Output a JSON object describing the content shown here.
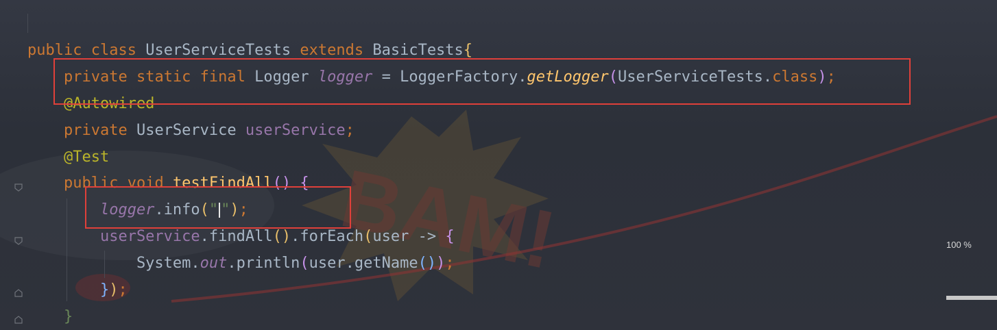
{
  "editor": {
    "zoom_level": "100 %",
    "lines": [
      {
        "tokens": [
          {
            "text": "public ",
            "cls": "kw"
          },
          {
            "text": "class ",
            "cls": "kw"
          },
          {
            "text": "UserServiceTests ",
            "cls": "cls"
          },
          {
            "text": "extends ",
            "cls": "kw"
          },
          {
            "text": "BasicTests",
            "cls": "cls"
          },
          {
            "text": "{",
            "cls": "paren1"
          }
        ]
      },
      {
        "tokens": [
          {
            "text": "    private ",
            "cls": "kw"
          },
          {
            "text": "static ",
            "cls": "kw"
          },
          {
            "text": "final ",
            "cls": "kw"
          },
          {
            "text": "Logger ",
            "cls": "cls"
          },
          {
            "text": "logger",
            "cls": "field-it"
          },
          {
            "text": " = LoggerFactory.",
            "cls": "plain"
          },
          {
            "text": "getLogger",
            "cls": "method-it"
          },
          {
            "text": "(",
            "cls": "paren2"
          },
          {
            "text": "UserServiceTests.",
            "cls": "plain"
          },
          {
            "text": "class",
            "cls": "kw"
          },
          {
            "text": ")",
            "cls": "paren2"
          },
          {
            "text": ";",
            "cls": "kw"
          }
        ]
      },
      {
        "tokens": [
          {
            "text": "    @Autowired",
            "cls": "ann"
          }
        ]
      },
      {
        "tokens": [
          {
            "text": "    private ",
            "cls": "kw"
          },
          {
            "text": "UserService ",
            "cls": "cls"
          },
          {
            "text": "userService",
            "cls": "field"
          },
          {
            "text": ";",
            "cls": "kw"
          }
        ]
      },
      {
        "tokens": [
          {
            "text": "    @Test",
            "cls": "ann"
          }
        ]
      },
      {
        "tokens": [
          {
            "text": "    public ",
            "cls": "kw"
          },
          {
            "text": "void ",
            "cls": "kw"
          },
          {
            "text": "testFindAll",
            "cls": "method"
          },
          {
            "text": "() ",
            "cls": "paren2"
          },
          {
            "text": "{",
            "cls": "paren2"
          }
        ]
      },
      {
        "tokens": [
          {
            "text": "        logger",
            "cls": "field-it"
          },
          {
            "text": ".info",
            "cls": "plain"
          },
          {
            "text": "(",
            "cls": "paren1"
          },
          {
            "text": "\"",
            "cls": "str"
          },
          {
            "text": "CARET",
            "cls": "caret"
          },
          {
            "text": "\"",
            "cls": "str"
          },
          {
            "text": ")",
            "cls": "paren1"
          },
          {
            "text": ";",
            "cls": "kw"
          }
        ]
      },
      {
        "tokens": [
          {
            "text": "        userService",
            "cls": "field"
          },
          {
            "text": ".findAll",
            "cls": "plain"
          },
          {
            "text": "()",
            "cls": "paren1"
          },
          {
            "text": ".forEach",
            "cls": "plain"
          },
          {
            "text": "(",
            "cls": "paren1"
          },
          {
            "text": "user -> ",
            "cls": "plain"
          },
          {
            "text": "{",
            "cls": "paren2"
          }
        ]
      },
      {
        "tokens": [
          {
            "text": "            System.",
            "cls": "plain"
          },
          {
            "text": "out",
            "cls": "field-it"
          },
          {
            "text": ".println",
            "cls": "plain"
          },
          {
            "text": "(",
            "cls": "paren2"
          },
          {
            "text": "user.getName",
            "cls": "plain"
          },
          {
            "text": "()",
            "cls": "paren3"
          },
          {
            "text": ")",
            "cls": "paren2"
          },
          {
            "text": ";",
            "cls": "kw"
          }
        ]
      },
      {
        "tokens": [
          {
            "text": "        ",
            "cls": "plain"
          },
          {
            "text": "}",
            "cls": "paren3"
          },
          {
            "text": ")",
            "cls": "paren1"
          },
          {
            "text": ";",
            "cls": "kw"
          }
        ]
      },
      {
        "tokens": [
          {
            "text": "    ",
            "cls": "plain"
          },
          {
            "text": "}",
            "cls": "str"
          }
        ]
      }
    ]
  },
  "colors": {
    "highlight_border": "#e0403a",
    "keyword": "#cc7832",
    "annotation": "#bbb529",
    "field": "#9876aa",
    "method": "#ffc66d",
    "string": "#6a8759"
  }
}
